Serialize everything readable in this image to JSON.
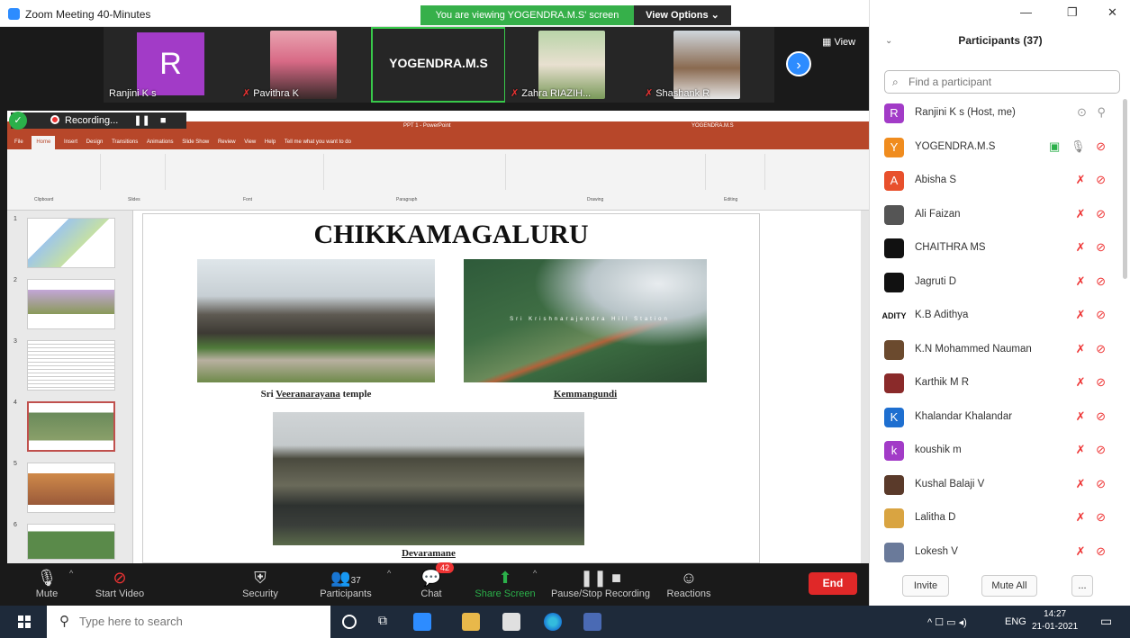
{
  "window": {
    "title": "Zoom Meeting 40-Minutes",
    "banner": "You are viewing YOGENDRA.M.S' screen",
    "view_options": "View Options ⌄"
  },
  "strip": {
    "tiles": [
      {
        "name": "Ranjini K s",
        "initial": "R"
      },
      {
        "name": "Pavithra K"
      },
      {
        "name": "YOGENDRA.M.S"
      },
      {
        "name": "Zahra RIAZIH..."
      },
      {
        "name": "Shashank R"
      }
    ],
    "view_label": "View",
    "next": "›"
  },
  "recording": {
    "label": "Recording...",
    "shield": "✓"
  },
  "ppt": {
    "doc_title": "PPT 1 - PowerPoint",
    "user": "YOGENDRA.M.S",
    "tabs": [
      "File",
      "Home",
      "Insert",
      "Design",
      "Transitions",
      "Animations",
      "Slide Show",
      "Review",
      "View",
      "Help",
      "Tell me what you want to do"
    ],
    "groups": [
      "Clipboard",
      "Slides",
      "Font",
      "Paragraph",
      "Drawing",
      "Editing"
    ],
    "thumb_numbers": [
      "1",
      "2",
      "3",
      "4",
      "5",
      "6"
    ],
    "slide": {
      "title": "CHIKKAMAGALURU",
      "cap1_pre": "Sri ",
      "cap1_u": "Veeranarayana",
      "cap1_post": " temple",
      "cap2": "Kemmangundi",
      "cap3": "Devaramane",
      "overlay": "Sri Krishnarajendra Hill Station"
    }
  },
  "toolbar": {
    "mute": "Mute",
    "start_video": "Start Video",
    "security": "Security",
    "participants": "Participants",
    "participants_count": "37",
    "chat": "Chat",
    "chat_badge": "42",
    "share": "Share Screen",
    "recording": "Pause/Stop Recording",
    "reactions": "Reactions",
    "end": "End"
  },
  "panel": {
    "header": "Participants (37)",
    "search_placeholder": "Find a participant",
    "participants": [
      {
        "name": "Ranjini K s (Host, me)",
        "initial": "R",
        "color": "#a23bc7"
      },
      {
        "name": "YOGENDRA.M.S",
        "initial": "Y",
        "color": "#f08c1e"
      },
      {
        "name": "Abisha S",
        "initial": "A",
        "color": "#e8502c"
      },
      {
        "name": "Ali Faizan",
        "initial": "",
        "color": "#555555"
      },
      {
        "name": "CHAITHRA MS",
        "initial": "",
        "color": "#111111"
      },
      {
        "name": "Jagruti D",
        "initial": "",
        "color": "#111111"
      },
      {
        "name": "K.B Adithya",
        "initial": "ADITY",
        "color": "#ffffff"
      },
      {
        "name": "K.N Mohammed Nauman",
        "initial": "",
        "color": "#6b4a2e"
      },
      {
        "name": "Karthik M R",
        "initial": "",
        "color": "#8a2a2a"
      },
      {
        "name": "Khalandar Khalandar",
        "initial": "K",
        "color": "#1e6fd0"
      },
      {
        "name": "koushik m",
        "initial": "k",
        "color": "#a23bc7"
      },
      {
        "name": "Kushal Balaji V",
        "initial": "",
        "color": "#5a3a2a"
      },
      {
        "name": "Lalitha D",
        "initial": "",
        "color": "#d9a441"
      },
      {
        "name": "Lokesh V",
        "initial": "",
        "color": "#6a7a9a"
      }
    ],
    "invite": "Invite",
    "mute_all": "Mute All",
    "more": "...",
    "win_min": "—",
    "win_max": "❐",
    "win_close": "✕",
    "collapse": "⌄"
  },
  "taskbar": {
    "search_placeholder": "Type here to search",
    "tray_lang": "ENG",
    "time": "14:27",
    "date": "21-01-2021"
  }
}
